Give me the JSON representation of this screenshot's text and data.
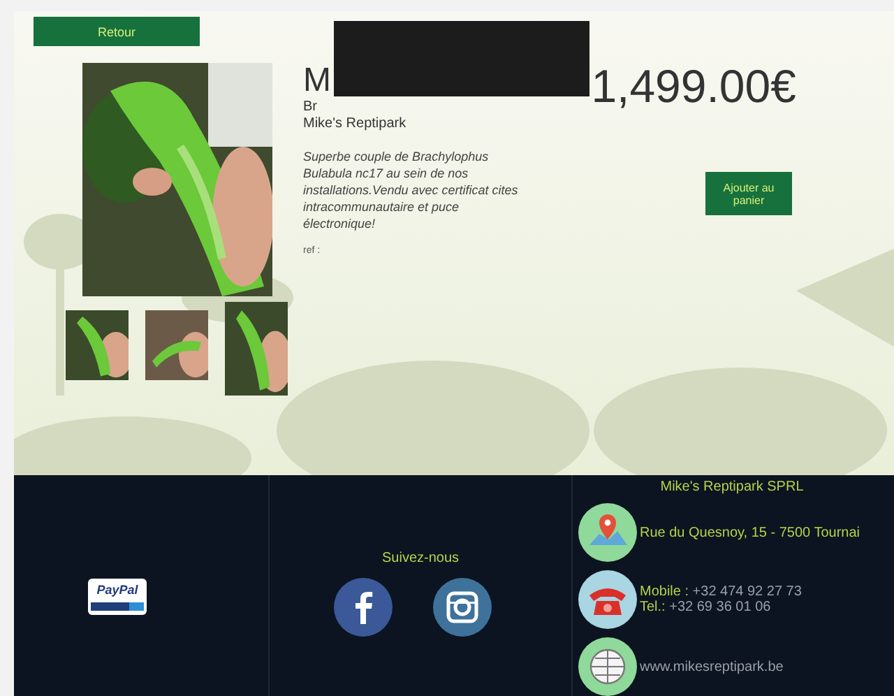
{
  "back_button": {
    "label": "Retour"
  },
  "product": {
    "title": "M",
    "subtitle": "Br",
    "seller": "Mike's Reptipark",
    "description": "Superbe couple de Brachylophus Bulabula nc17 au sein de nos installations.Vendu avec certificat cites intracommunautaire et puce électronique!",
    "ref": "ref :",
    "price": "1,499.00€",
    "cart_button": "Ajouter au panier"
  },
  "footer": {
    "payment_logo": "PayPal",
    "follow_title": "Suivez-nous",
    "company": "Mike's Reptipark SPRL",
    "address": "Rue du Quesnoy, 15 - 7500 Tournai",
    "phones": [
      {
        "label": "Mobile :",
        "number": "+32 474 92 27 73"
      },
      {
        "label": "Tel.:",
        "number": "+32 69 36 01 06"
      }
    ],
    "website": "www.mikesreptipark.be"
  }
}
